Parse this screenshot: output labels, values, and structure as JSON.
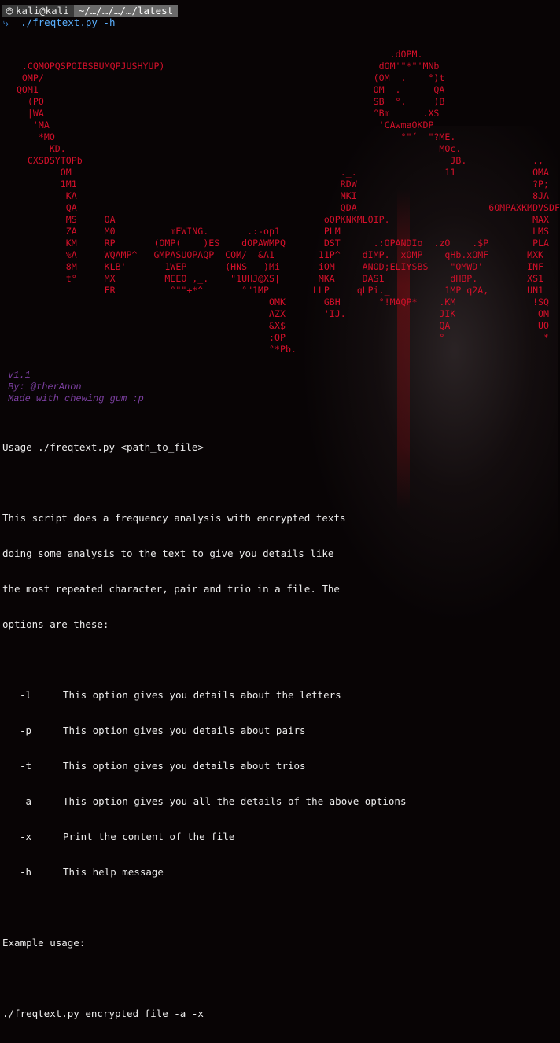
{
  "prompt": {
    "user": "kali@kali",
    "path": "~/…/…/…/…/latest",
    "command": "./freqtext.py -h"
  },
  "colors": {
    "art": "#d3102a",
    "credits": "#7b3fa0",
    "prompt_accent": "#4aa3ff",
    "text": "#ececec"
  },
  "ascii_art": [
    "                                                                       .dOPM.",
    "    .CQMOPQSPOIBSBUMQPJUSHYUP)                                       dOM'\"*\"'MNb",
    "    OMP/                                                            (OM  .    °)t",
    "   QOM1                                                             OM  .      QA",
    "     (PO                                                            SB  °.     )B",
    "     |WA                                                            °Bm      .XS",
    "      'MA                                                            'CAwmaOKDP",
    "       *MO                                                               °\"´  \"?ME.",
    "         KD.                                                                    MOc.",
    "     CXSDSYTOPb                                                                   JB.            .,",
    "           OM                                                 ._.                11              OMA",
    "           1M1                                                RDW                                ?P;",
    "            KA                                                MKI                                8JA",
    "            QA                                                QDA                        6OMPAXKMDVSDFB",
    "            MS     OA                                      oOPKNKMLOIP.                          MAX",
    "            ZA     M0          mEWING.       .:-op1        PLM                                   LMS",
    "            KM     RP       (OMP(    )ES    dOPAWMPQ       DST      .:OPANDIo  .zO    .$P        PLA",
    "            %A     WQAMP^   GMPASUOPAQP  COM/  &A1        11P^    dIMP.  xOMP    qHb.xOMF       MXK",
    "            8M     KLB'       1WEP       (HNS   )Mi       iOM     ANOD;ELIYSBS    \"OMWD'        INF",
    "            t°     MX         MEEO ,_.    \"1UHJ@XS|       MKA     DAS1            dHBP.         XS1",
    "                   FR          °\"\"+*^       °\"1MP        LLP     qLPi._          1MP q2A,       UN1",
    "                                                 OMK       GBH       °!MAQP*    .KM              !SQ",
    "                                                 AZX       'IJ.                 JIK               OM",
    "                                                 &X$                            QA                UO",
    "                                                 :OP                            °                  *",
    "                                                 °*Pb."
  ],
  "credits": [
    "v1.1",
    "By: @therAnon",
    "Made with chewing gum :p"
  ],
  "help": {
    "usage": "Usage ./freqtext.py <path_to_file>",
    "description": [
      "This script does a frequency analysis with encrypted texts",
      "doing some analysis to the text to give you details like",
      "the most repeated character, pair and trio in a file. The",
      "options are these:"
    ],
    "options": [
      {
        "flag": "-l",
        "text": "This option gives you details about the letters"
      },
      {
        "flag": "-p",
        "text": "This option gives you details about pairs"
      },
      {
        "flag": "-t",
        "text": "This option gives you details about trios"
      },
      {
        "flag": "-a",
        "text": "This option gives you all the details of the above options"
      },
      {
        "flag": "-x",
        "text": "Print the content of the file"
      },
      {
        "flag": "-h",
        "text": "This help message"
      }
    ],
    "example_label": "Example usage:",
    "example_command": "./freqtext.py encrypted_file -a -x"
  }
}
